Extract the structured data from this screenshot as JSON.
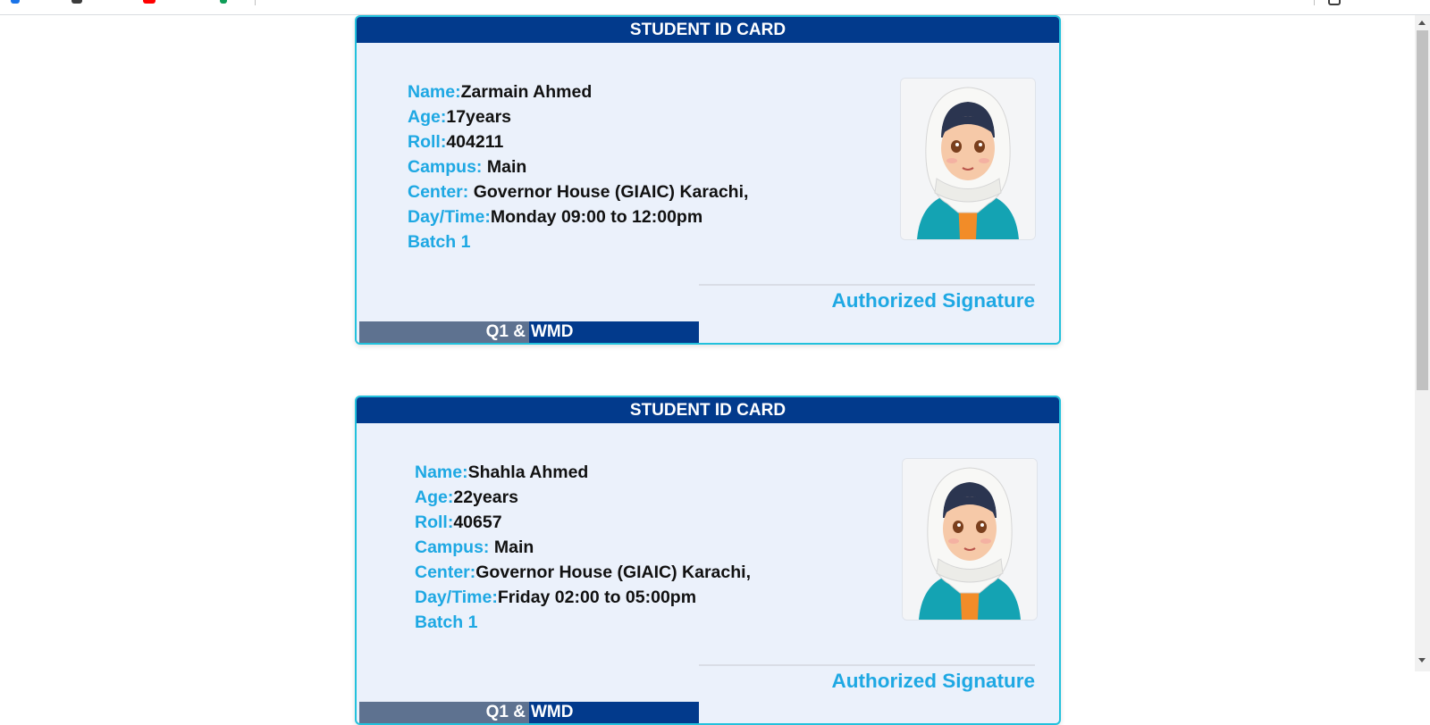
{
  "colors": {
    "header_bg": "#023a8c",
    "label": "#1ea8e3",
    "card_bg": "#ebf1fb",
    "card_border": "#22c1dc",
    "footer_left": "#5e7290"
  },
  "cards": [
    {
      "header": "STUDENT ID CARD",
      "fields": [
        {
          "label": "Name:",
          "value": "Zarmain Ahmed"
        },
        {
          "label": "Age:",
          "value": "17years"
        },
        {
          "label": "Roll:",
          "value": "404211"
        },
        {
          "label": "Campus: ",
          "value": "Main"
        },
        {
          "label": "Center: ",
          "value": "Governor House (GIAIC) Karachi,"
        },
        {
          "label": "Day/Time:",
          "value": "Monday 09:00 to 12:00pm"
        },
        {
          "label": "Batch 1",
          "value": ""
        }
      ],
      "photo_icon": "student-avatar-icon",
      "signature": "Authorized Signature",
      "footer_left": "Q1 &",
      "footer_right": "WMD"
    },
    {
      "header": "STUDENT ID CARD",
      "fields": [
        {
          "label": "Name:",
          "value": "Shahla Ahmed"
        },
        {
          "label": "Age:",
          "value": "22years"
        },
        {
          "label": "Roll:",
          "value": "40657"
        },
        {
          "label": "Campus: ",
          "value": "Main"
        },
        {
          "label": "Center:",
          "value": "Governor House (GIAIC) Karachi,"
        },
        {
          "label": "Day/Time:",
          "value": "Friday 02:00 to 05:00pm"
        },
        {
          "label": "Batch 1",
          "value": ""
        }
      ],
      "photo_icon": "student-avatar-icon",
      "signature": "Authorized Signature",
      "footer_left": "Q1 &",
      "footer_right": "WMD"
    }
  ]
}
